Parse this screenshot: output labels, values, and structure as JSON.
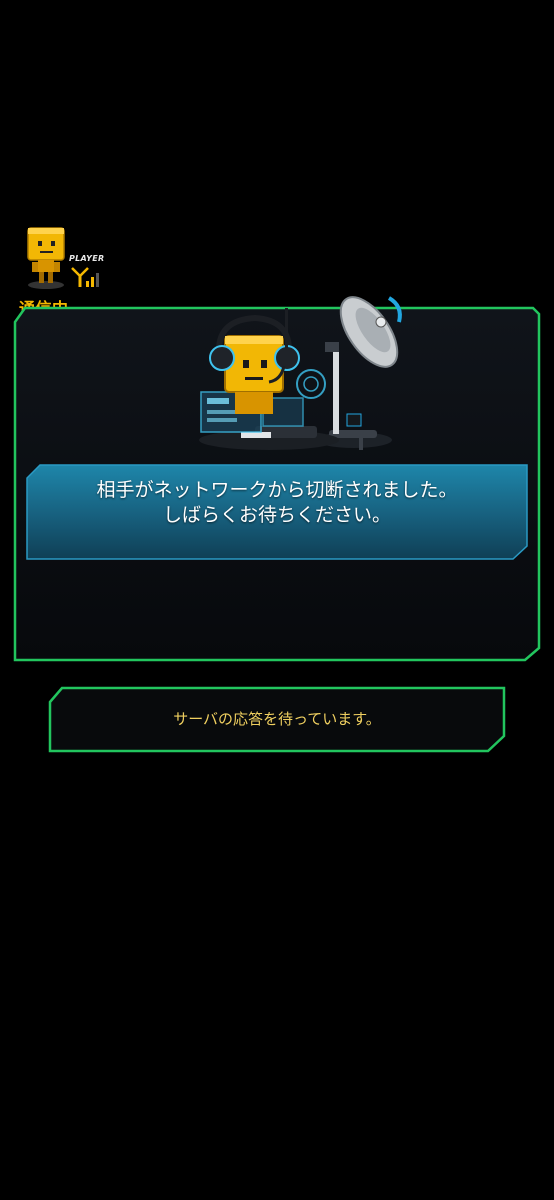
{
  "player": {
    "label": "PLAYER",
    "status": "通信中..."
  },
  "dialog": {
    "message_line1": "相手がネットワークから切断されました。",
    "message_line2": "しばらくお待ちください。"
  },
  "status_panel": {
    "text": "サーバの応答を待っています。"
  },
  "colors": {
    "frame_green": "#22c55e",
    "banner_blue": "#1a6f8e",
    "status_text": "#f0d060",
    "connecting_yellow": "#f5b800"
  },
  "icons": [
    "player-avatar-icon",
    "signal-icon",
    "operator-robot-illustration",
    "satellite-dish-icon"
  ]
}
